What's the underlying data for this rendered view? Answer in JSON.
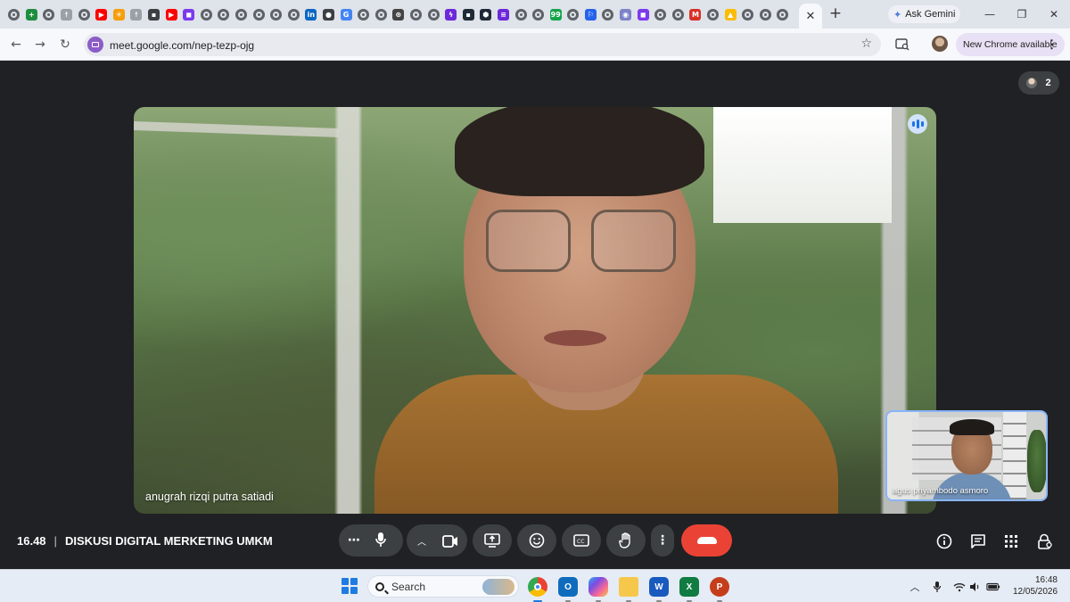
{
  "browser": {
    "tabs": {
      "favicons": [
        {
          "icon": "globe-icon",
          "color": "#5f6368",
          "glyph": ""
        },
        {
          "icon": "sheets-icon",
          "color": "#1e8e3e",
          "glyph": "+"
        },
        {
          "icon": "globe-icon",
          "color": "#5f6368",
          "glyph": ""
        },
        {
          "icon": "tree-icon",
          "color": "#9aa0a6",
          "glyph": "☨"
        },
        {
          "icon": "globe-icon",
          "color": "#5f6368",
          "glyph": ""
        },
        {
          "icon": "youtube-icon",
          "color": "#ff0000",
          "glyph": "▶"
        },
        {
          "icon": "sparkle-icon",
          "color": "#f59e0b",
          "glyph": "✳"
        },
        {
          "icon": "tree-icon",
          "color": "#9aa0a6",
          "glyph": "☨"
        },
        {
          "icon": "dark-square-icon",
          "color": "#3c4043",
          "glyph": "▪"
        },
        {
          "icon": "youtube-icon",
          "color": "#ff0000",
          "glyph": "▶"
        },
        {
          "icon": "chat-icon",
          "color": "#7c3aed",
          "glyph": "◼"
        },
        {
          "icon": "globe-icon",
          "color": "#5f6368",
          "glyph": ""
        },
        {
          "icon": "globe-icon",
          "color": "#5f6368",
          "glyph": ""
        },
        {
          "icon": "globe-icon",
          "color": "#5f6368",
          "glyph": ""
        },
        {
          "icon": "globe-icon",
          "color": "#5f6368",
          "glyph": ""
        },
        {
          "icon": "globe-icon",
          "color": "#5f6368",
          "glyph": ""
        },
        {
          "icon": "globe-icon",
          "color": "#5f6368",
          "glyph": ""
        },
        {
          "icon": "linkedin-icon",
          "color": "#0a66c2",
          "glyph": "in"
        },
        {
          "icon": "record-icon",
          "color": "#3c4043",
          "glyph": "●"
        },
        {
          "icon": "google-icon",
          "color": "#4285f4",
          "glyph": "G"
        },
        {
          "icon": "globe-icon",
          "color": "#5f6368",
          "glyph": ""
        },
        {
          "icon": "globe-icon",
          "color": "#5f6368",
          "glyph": ""
        },
        {
          "icon": "chatgpt-icon",
          "color": "#444444",
          "glyph": "⊛"
        },
        {
          "icon": "globe-icon",
          "color": "#5f6368",
          "glyph": ""
        },
        {
          "icon": "globe-icon",
          "color": "#5f6368",
          "glyph": ""
        },
        {
          "icon": "bolt-icon",
          "color": "#6d28d9",
          "glyph": "ϟ"
        },
        {
          "icon": "dark-square-icon",
          "color": "#1f2937",
          "glyph": "▪"
        },
        {
          "icon": "hex-icon",
          "color": "#1f2937",
          "glyph": "⬢"
        },
        {
          "icon": "list-icon",
          "color": "#6d28d9",
          "glyph": "≡"
        },
        {
          "icon": "globe-icon",
          "color": "#5f6368",
          "glyph": ""
        },
        {
          "icon": "globe-icon",
          "color": "#5f6368",
          "glyph": ""
        },
        {
          "icon": "green-badge-icon",
          "color": "#16a34a",
          "glyph": "99"
        },
        {
          "icon": "globe-icon",
          "color": "#5f6368",
          "glyph": ""
        },
        {
          "icon": "runner-icon",
          "color": "#2563eb",
          "glyph": "⚐"
        },
        {
          "icon": "globe-icon",
          "color": "#5f6368",
          "glyph": ""
        },
        {
          "icon": "puzzle-icon",
          "color": "#7c83c8",
          "glyph": "◉"
        },
        {
          "icon": "chat-icon",
          "color": "#7c3aed",
          "glyph": "◼"
        },
        {
          "icon": "globe-icon",
          "color": "#5f6368",
          "glyph": ""
        },
        {
          "icon": "globe-icon",
          "color": "#5f6368",
          "glyph": ""
        },
        {
          "icon": "gmail-icon",
          "color": "#d93025",
          "glyph": "M"
        },
        {
          "icon": "globe-icon",
          "color": "#5f6368",
          "glyph": ""
        },
        {
          "icon": "drive-icon",
          "color": "#fbbc04",
          "glyph": "▲"
        },
        {
          "icon": "globe-icon",
          "color": "#5f6368",
          "glyph": ""
        },
        {
          "icon": "globe-icon",
          "color": "#5f6368",
          "glyph": ""
        },
        {
          "icon": "globe-icon",
          "color": "#5f6368",
          "glyph": ""
        }
      ],
      "active_close": "✕",
      "new_tab": "+"
    },
    "ask_gemini": "Ask Gemini",
    "window_controls": {
      "minimize": "—",
      "restore": "❐",
      "close": "✕"
    },
    "url": "meet.google.com/nep-tezp-ojg",
    "new_chrome": "New Chrome available"
  },
  "meet": {
    "participant_count": "2",
    "main_participant": "anugrah rizqi putra satiadi",
    "self_participant": "agus priyambodo asmoro",
    "time": "16.48",
    "separator": "|",
    "meeting_title": "DISKUSI DIGITAL MERKETING UMKM",
    "accent_end_call": "#ea4335",
    "accent_speaking": "#1a73e8"
  },
  "taskbar": {
    "search_label": "Search",
    "apps": [
      "chrome-icon",
      "outlook-icon",
      "copilot-icon",
      "file-explorer-icon",
      "word-icon",
      "excel-icon",
      "powerpoint-icon"
    ],
    "time": "16:48",
    "date": "12/05/2026"
  }
}
